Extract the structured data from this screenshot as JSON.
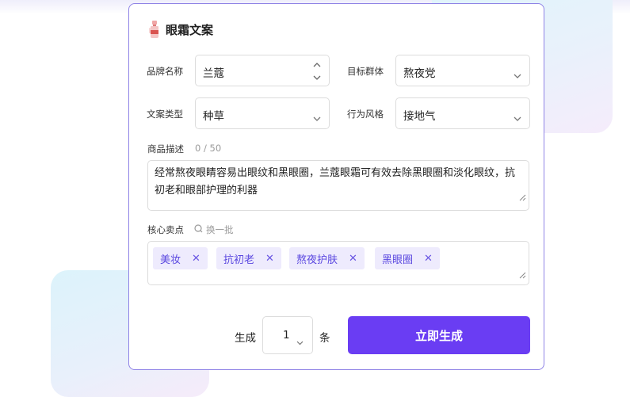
{
  "form": {
    "title": "眼霜文案",
    "brand_label": "品牌名称",
    "brand_value": "兰蔻",
    "audience_label": "目标群体",
    "audience_value": "熬夜党",
    "copy_type_label": "文案类型",
    "copy_type_value": "种草",
    "style_label": "行为风格",
    "style_value": "接地气",
    "description_label": "商品描述",
    "description_counter": "0 / 50",
    "description_value": "经常熬夜眼睛容易出眼纹和黑眼圈，兰蔻眼霜可有效去除黑眼圈和淡化眼纹，抗初老和眼部护理的利器",
    "selling_points_label": "核心卖点",
    "refresh_label": "换一批",
    "selling_points": [
      "美妆",
      "抗初老",
      "熬夜护肤",
      "黑眼圈"
    ],
    "tag_close_glyph": "✕",
    "generate_label": "生成",
    "count_value": "1",
    "count_unit": "条",
    "submit_label": "立即生成"
  },
  "colors": {
    "accent": "#6a3df3",
    "card_border": "#8f83e6",
    "tag_bg": "#eeebfd",
    "tag_text": "#5b48e0"
  },
  "icons": {
    "title_icon": "cream-bottle-icon",
    "refresh_icon": "refresh-icon",
    "select_icon": "chevron-down-icon",
    "stepper_icon": "stepper-arrows-icon",
    "tag_close_icon": "close-icon",
    "resize_icon": "resize-handle-icon"
  }
}
